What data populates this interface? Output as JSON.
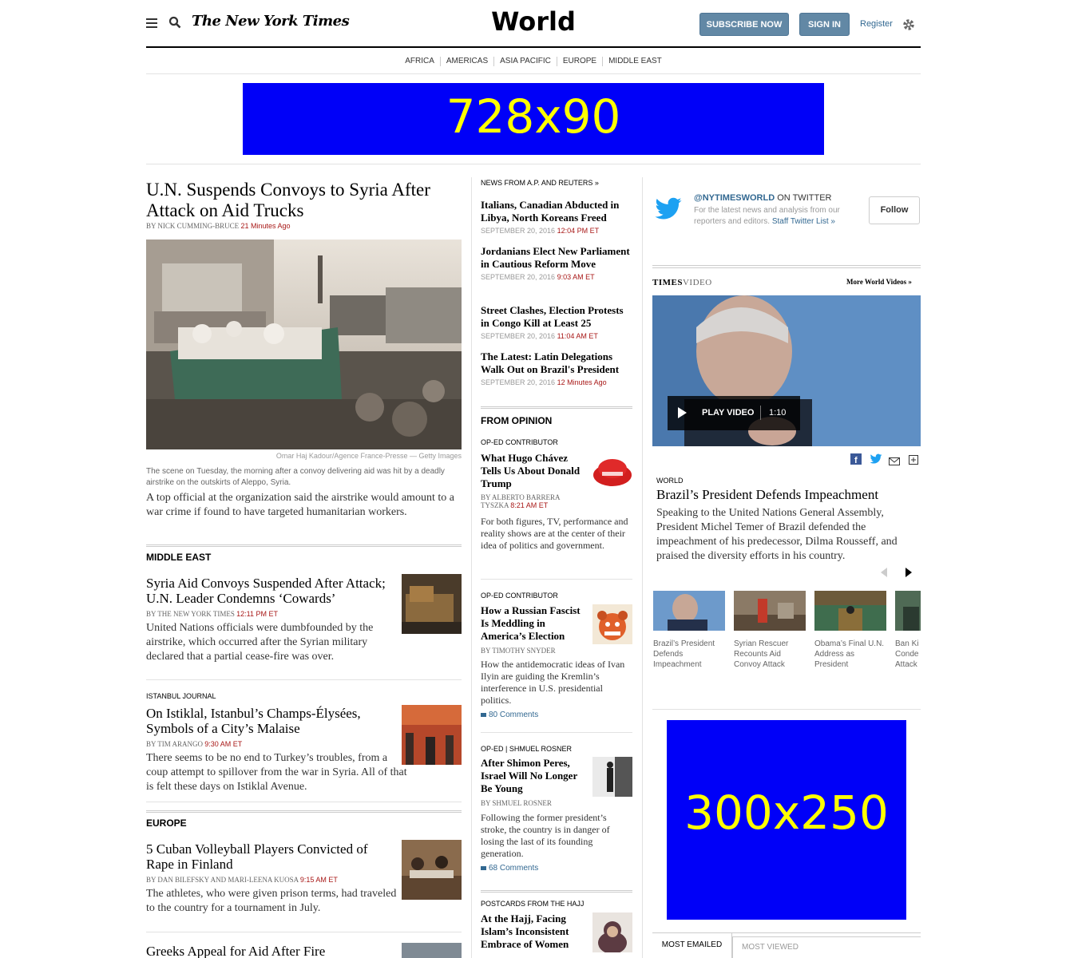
{
  "masthead": {
    "logo": "The New York Times",
    "section_title": "World",
    "subscribe": "Subscribe Now",
    "signin": "Sign In",
    "register": "Register"
  },
  "nav": [
    "AFRICA",
    "AMERICAS",
    "ASIA PACIFIC",
    "EUROPE",
    "MIDDLE EAST"
  ],
  "ads": {
    "top": "728x90",
    "side": "300x250"
  },
  "lead": {
    "headline": "U.N. Suspends Convoys to Syria After Attack on Aid Trucks",
    "byline": "By NICK CUMMING-BRUCE",
    "time": "21 Minutes Ago",
    "credit": "Omar Haj Kadour/Agence France-Presse — Getty Images",
    "caption": "The scene on Tuesday, the morning after a convoy delivering aid was hit by a deadly airstrike on the outskirts of Aleppo, Syria.",
    "summary": "A top official at the organization said the airstrike would amount to a war crime if found to have targeted humanitarian workers."
  },
  "middle_east": {
    "heading": "Middle East",
    "story": {
      "headline": "Syria Aid Convoys Suspended After Attack; U.N. Leader Condemns ‘Cowards’",
      "byline": "By THE NEW YORK TIMES",
      "time": "12:11 PM ET",
      "summary": "United Nations officials were dumbfounded by the airstrike, which occurred after the Syrian military declared that a partial cease-fire was over."
    }
  },
  "istanbul": {
    "kicker": "Istanbul Journal",
    "headline": "On Istiklal, Istanbul’s Champs-Élysées, Symbols of a City’s Malaise",
    "byline": "By TIM ARANGO",
    "time": "9:30 AM ET",
    "summary": "There seems to be no end to Turkey’s troubles, from a coup attempt to spillover from the war in Syria. All of that is felt these days on Istiklal Avenue."
  },
  "europe": {
    "heading": "Europe",
    "story": {
      "headline": "5 Cuban Volleyball Players Convicted of Rape in Finland",
      "byline": "By DAN BILEFSKY and MARI-LEENA KUOSA",
      "time": "9:15 AM ET",
      "summary": "The athletes, who were given prison terms, had traveled to the country for a tournament in July."
    },
    "next_headline": "Greeks Appeal for Aid After Fire"
  },
  "wire": {
    "heading": "News from A.P. and Reuters »",
    "items": [
      {
        "headline": "Italians, Canadian Abducted in Libya, North Koreans Freed",
        "date": "September 20, 2016",
        "time": "12:04 PM ET"
      },
      {
        "headline": "Jordanians Elect New Parliament in Cautious Reform Move",
        "date": "September 20, 2016",
        "time": "9:03 AM ET"
      },
      {
        "headline": "Street Clashes, Election Protests in Congo Kill at Least 25",
        "date": "September 20, 2016",
        "time": "11:04 AM ET"
      },
      {
        "headline": "The Latest: Latin Delegations Walk Out on Brazil's President",
        "date": "September 20, 2016",
        "time": "12 Minutes Ago"
      }
    ]
  },
  "opinion": {
    "heading": "From Opinion",
    "items": [
      {
        "kicker": "Op-Ed Contributor",
        "headline": "What Hugo Chávez Tells Us About Donald Trump",
        "byline": "By ALBERTO BARRERA TYSZKA",
        "time": "8:21 AM ET",
        "summary": "For both figures, TV, performance and reality shows are at the center of their idea of politics and government.",
        "comments": ""
      },
      {
        "kicker": "Op-Ed Contributor",
        "headline": "How a Russian Fascist Is Meddling in America’s Election",
        "byline": "By TIMOTHY SNYDER",
        "time": "",
        "summary": "How the antidemocratic ideas of Ivan Ilyin are guiding the Kremlin’s interference in U.S. presidential politics.",
        "comments": "80 Comments"
      },
      {
        "kicker": "Op-Ed | Shmuel Rosner",
        "headline": "After Shimon Peres, Israel Will No Longer Be Young",
        "byline": "By SHMUEL ROSNER",
        "time": "",
        "summary": "Following the former president’s stroke, the country is in danger of losing the last of its founding generation.",
        "comments": "68 Comments"
      },
      {
        "kicker": "Postcards From the Hajj",
        "headline": "At the Hajj, Facing Islam’s Inconsistent Embrace of Women",
        "byline": "",
        "time": "",
        "summary": "",
        "comments": ""
      }
    ]
  },
  "twitter": {
    "handle": "@NYTIMESWORLD",
    "on": "ON TWITTER",
    "desc": "For the latest news and analysis from our reporters and editors.",
    "list_link": "Staff Twitter List »",
    "follow": "Follow"
  },
  "video": {
    "logo_times": "TIMES",
    "logo_video": "VIDEO",
    "more": "More World Videos »",
    "play": "PLAY VIDEO",
    "duration": "1:10",
    "kicker": "World",
    "headline": "Brazil’s President Defends Impeachment",
    "summary": "Speaking to the United Nations General Assembly, President Michel Temer of Brazil defended the impeachment of his predecessor, Dilma Rousseff, and praised the diversity efforts in his country.",
    "thumbs": [
      "Brazil’s President Defends Impeachment",
      "Syrian Rescuer Recounts Aid Convoy Attack",
      "Obama’s Final U.N. Address as President",
      "Ban Ki Conde Attack"
    ]
  },
  "popular": {
    "tab1": "Most Emailed",
    "tab2": "Most Viewed"
  },
  "colors": {
    "accent": "#326891",
    "red": "#a81817",
    "ad": "#0000f8"
  }
}
